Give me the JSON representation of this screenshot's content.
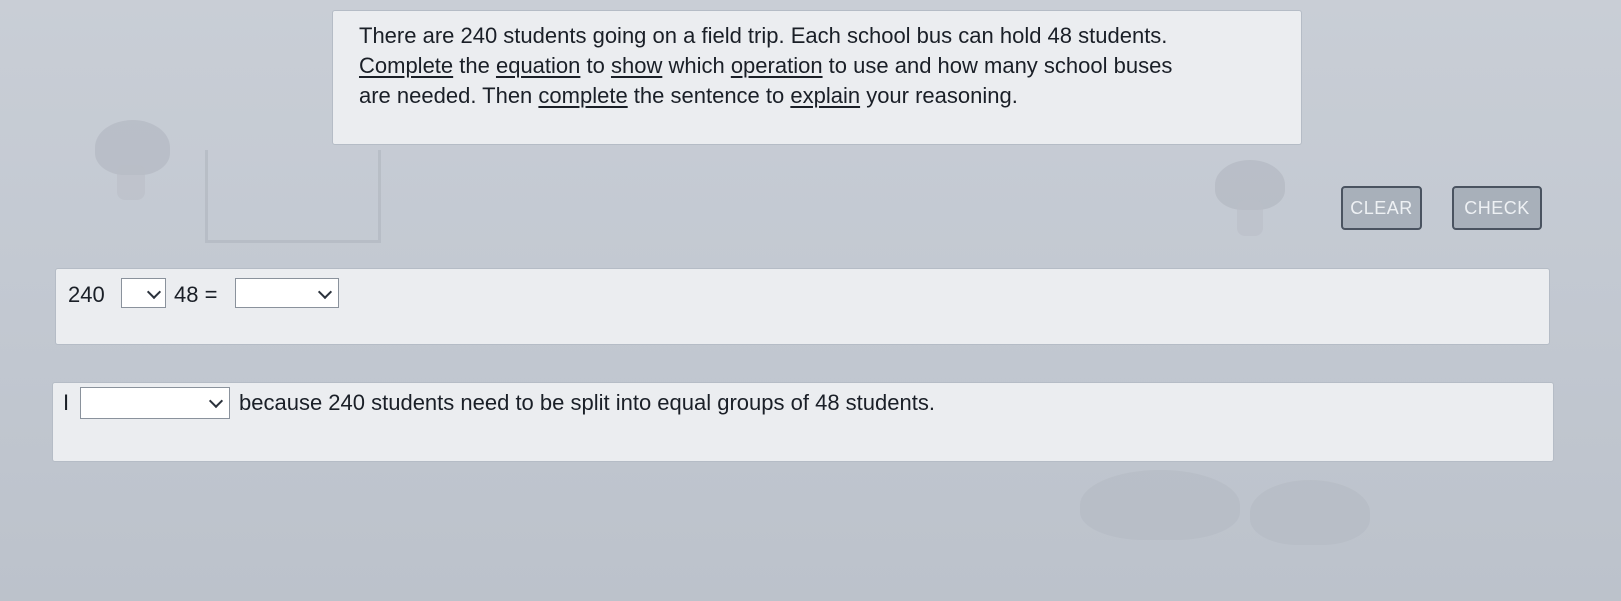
{
  "prompt": {
    "lines": [
      [
        {
          "t": "There are 240 students going on a field trip. Each school bus can hold 48 students.",
          "u": false
        }
      ],
      [
        {
          "t": "Complete",
          "u": true
        },
        {
          "t": " the ",
          "u": false
        },
        {
          "t": "equation",
          "u": true
        },
        {
          "t": " to ",
          "u": false
        },
        {
          "t": "show",
          "u": true
        },
        {
          "t": " which ",
          "u": false
        },
        {
          "t": "operation",
          "u": true
        },
        {
          "t": " to use and how many school buses",
          "u": false
        }
      ],
      [
        {
          "t": "are needed. Then ",
          "u": false
        },
        {
          "t": "complete",
          "u": true
        },
        {
          "t": " the sentence to ",
          "u": false
        },
        {
          "t": "explain",
          "u": true
        },
        {
          "t": " your reasoning.",
          "u": false
        }
      ]
    ]
  },
  "buttons": {
    "clear": "CLEAR",
    "check": "CHECK"
  },
  "equation": {
    "left_operand": "240",
    "operator_value": "",
    "right_operand": "48 =",
    "result_value": ""
  },
  "sentence": {
    "lead": "I",
    "choice_value": "",
    "text": "because 240 students need to be split into equal groups of 48 students."
  }
}
